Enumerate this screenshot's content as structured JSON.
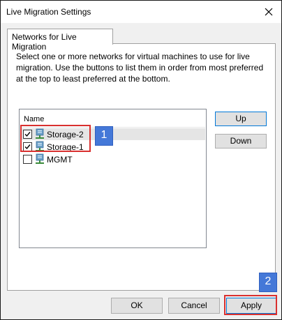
{
  "window": {
    "title": "Live Migration Settings"
  },
  "tabs": [
    {
      "label": "Networks for Live Migration"
    }
  ],
  "description": "Select one or more networks for virtual machines to use for live migration. Use the buttons to list them in order from most preferred at the top to least preferred at the bottom.",
  "network_list": {
    "header": "Name",
    "items": [
      {
        "label": "Storage-2",
        "checked": true,
        "selected": true
      },
      {
        "label": "Storage-1",
        "checked": true,
        "selected": false
      },
      {
        "label": "MGMT",
        "checked": false,
        "selected": false
      }
    ]
  },
  "side_buttons": {
    "up": "Up",
    "down": "Down"
  },
  "footer_buttons": {
    "ok": "OK",
    "cancel": "Cancel",
    "apply": "Apply"
  },
  "annotations": {
    "badge1": "1",
    "badge2": "2"
  },
  "colors": {
    "highlight": "#d9302f",
    "badge": "#4478d8",
    "focus": "#0078d7"
  },
  "icons": {
    "close": "close-icon",
    "network": "network-adapter-icon",
    "check": "checkmark-icon"
  }
}
